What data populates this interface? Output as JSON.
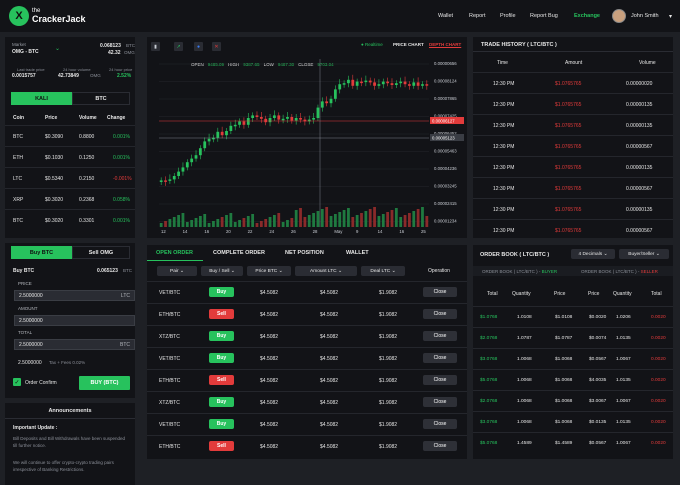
{
  "brand": {
    "line1": "the",
    "line2": "CrackerJack",
    "mark": "X"
  },
  "nav": {
    "items": [
      "Wallet",
      "Report",
      "Profile",
      "Report Bug",
      "Exchange"
    ],
    "active": "Exchange",
    "user": "John Smith",
    "caret": "▾"
  },
  "market": {
    "label": "Market",
    "pair": "OMG - BTC",
    "price_btc": "0.068123",
    "price_btc_unit": "BTC",
    "price_omg": "42.32",
    "price_omg_unit": "OMG",
    "stats": [
      {
        "label": "Last trade price",
        "value": "0.0015757"
      },
      {
        "label": "24 hour volume",
        "value": "42.73849",
        "unit": "OMG"
      },
      {
        "label": "24 hour price",
        "value": "2.52%"
      }
    ]
  },
  "coin_tabs": [
    "KALI",
    "BTC"
  ],
  "coin_table": {
    "headers": [
      "Coin",
      "Price",
      "Volume",
      "Change"
    ],
    "rows": [
      [
        "BTC",
        "$0.3090",
        "0.8800",
        "0.001%",
        "g"
      ],
      [
        "ETH",
        "$0.1030",
        "0.1250",
        "0.001%",
        "g"
      ],
      [
        "LTC",
        "$0.5340",
        "0.2150",
        "-0.001%",
        "r"
      ],
      [
        "XRP",
        "$0.3020",
        "0.2368",
        "0.058%",
        "g"
      ],
      [
        "BTC",
        "$0.3020",
        "0.3301",
        "0.001%",
        "g"
      ]
    ]
  },
  "order_form": {
    "tabs": [
      "Buy BTC",
      "Sell OMG"
    ],
    "title": "Buy BTC",
    "balance": "0.065123",
    "balance_unit": "BTC",
    "price_label": "PRICE",
    "price": "2.5000000",
    "price_unit": "LTC",
    "amount_label": "AMOUNT",
    "amount": "2.5000000",
    "total_label": "TOTAL",
    "total": "2.5000000",
    "total_unit": "BTC",
    "fee_value": "2.5000000",
    "fee_note": "Tax + Fees 0.02%",
    "confirm_label": "Order Confirm",
    "submit": "BUY (BTC)"
  },
  "announcements": {
    "title": "Announcements",
    "heading": "Important Update :",
    "body1": "Bill Deposits and Bill Withdrawals have been suspended till further notice.",
    "body2": "We will continue to offer crypto-crypto trading pairs irrespective of Banking Restrictions."
  },
  "chart": {
    "toolbar_icons": [
      "candles-icon",
      "line-icon",
      "indicator-icon",
      "close-icon"
    ],
    "realtime": "Realtime",
    "tabs": [
      "PRICE CHART",
      "DEPTH CHART"
    ],
    "ohlc": [
      {
        "k": "OPEN",
        "v": "9485.09"
      },
      {
        "k": "HIGH",
        "v": "9387.65"
      },
      {
        "k": "LOW",
        "v": "9487.30"
      },
      {
        "k": "CLOSE",
        "v": "9703.04"
      }
    ],
    "y_ticks": [
      "0.00000656",
      "0.00008124",
      "0.00007865",
      "0.00007425",
      "0.00006452",
      "0.00005463",
      "0.00004236",
      "0.00003245",
      "0.00002415",
      "0.00001234"
    ],
    "price_tag": "0.00006127",
    "cross_tag": "0.00005123",
    "x_ticks": [
      "12",
      "14",
      "16",
      "20",
      "22",
      "24",
      "26",
      "28",
      "May",
      "9",
      "14",
      "16",
      "25"
    ]
  },
  "trade_history": {
    "title": "TRADE HISTORY ( LTC/BTC )",
    "headers": [
      "Time",
      "Amount",
      "Volume"
    ],
    "rows": [
      [
        "12:30 PM",
        "$1.0765765",
        "0.00000020"
      ],
      [
        "12:30 PM",
        "$1.0765765",
        "0.00000135"
      ],
      [
        "12:30 PM",
        "$1.0765765",
        "0.00000135"
      ],
      [
        "12:30 PM",
        "$1.0765765",
        "0.00000567"
      ],
      [
        "12:30 PM",
        "$1.0765765",
        "0.00000135"
      ],
      [
        "12:30 PM",
        "$1.0765765",
        "0.00000567"
      ],
      [
        "12:30 PM",
        "$1.0765765",
        "0.00000135"
      ],
      [
        "12:30 PM",
        "$1.0765765",
        "0.00000567"
      ]
    ]
  },
  "orders": {
    "tabs": [
      "OPEN ORDER",
      "COMPLETE ORDER",
      "NET POSITION",
      "WALLET"
    ],
    "headers": [
      "Pair",
      "Buy / Sell",
      "Price BTC",
      "Amount LTC",
      "Deal LTC",
      "Operation"
    ],
    "rows": [
      [
        "VET/BTC",
        "Buy",
        "$4.5082",
        "$4.5082",
        "$1.9082",
        "Close"
      ],
      [
        "ETH/BTC",
        "Sell",
        "$4.5082",
        "$4.5082",
        "$1.9082",
        "Close"
      ],
      [
        "XTZ/BTC",
        "Buy",
        "$4.5082",
        "$4.5082",
        "$1.9082",
        "Close"
      ],
      [
        "VET/BTC",
        "Buy",
        "$4.5082",
        "$4.5082",
        "$1.9082",
        "Close"
      ],
      [
        "ETH/BTC",
        "Sell",
        "$4.5082",
        "$4.5082",
        "$1.9082",
        "Close"
      ],
      [
        "XTZ/BTC",
        "Buy",
        "$4.5082",
        "$4.5082",
        "$1.9082",
        "Close"
      ],
      [
        "VET/BTC",
        "Buy",
        "$4.5082",
        "$4.5082",
        "$1.9082",
        "Close"
      ],
      [
        "ETH/BTC",
        "Sell",
        "$4.5082",
        "$4.5082",
        "$1.9082",
        "Close"
      ]
    ]
  },
  "order_book": {
    "title": "ORDER BOOK ( LTC/BTC )",
    "decimals": "4 Decimals",
    "mode": "Buyer/Seller",
    "buyer_label": "ORDER BOOK ( LTC/BTC ) - ",
    "buyer_tag": "BUYER",
    "seller_label": "ORDER BOOK ( LTC/BTC ) - ",
    "seller_tag": "SELLER",
    "headers": [
      "Total",
      "Quantity",
      "Price",
      "Price",
      "Quantity",
      "Total"
    ],
    "rows": [
      [
        "$1.0768",
        "1.0108",
        "$1.0108",
        "$0.0020",
        "1.0206",
        "0.0020"
      ],
      [
        "$2.0768",
        "1.0787",
        "$1.0787",
        "$0.0074",
        "1.0135",
        "0.0020"
      ],
      [
        "$3.0768",
        "1.0068",
        "$1.0068",
        "$0.0567",
        "1.0067",
        "0.0020"
      ],
      [
        "$5.0768",
        "1.0068",
        "$1.0068",
        "$4.0035",
        "1.0135",
        "0.0020"
      ],
      [
        "$2.0768",
        "1.0068",
        "$1.0068",
        "$3.0067",
        "1.0067",
        "0.0020"
      ],
      [
        "$3.0768",
        "1.0068",
        "$1.0068",
        "$0.0135",
        "1.0135",
        "0.0020"
      ],
      [
        "$5.0768",
        "1.4589",
        "$1.4589",
        "$0.0567",
        "1.0067",
        "0.0020"
      ]
    ]
  }
}
